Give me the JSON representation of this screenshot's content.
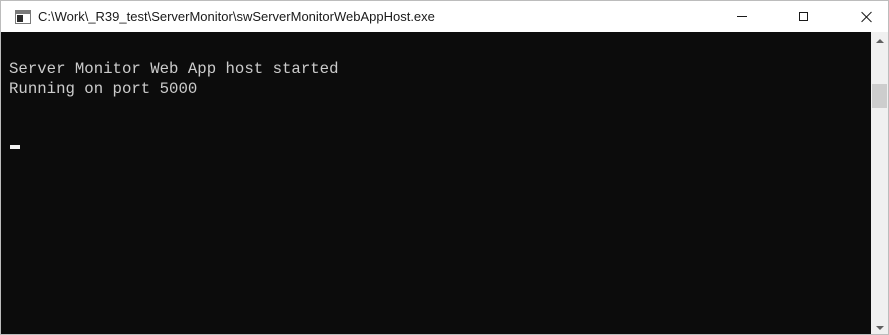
{
  "window": {
    "title": "C:\\Work\\_R39_test\\ServerMonitor\\swServerMonitorWebAppHost.exe",
    "icon": "console-app-icon"
  },
  "title_controls": {
    "minimize_icon": "minimize-icon",
    "maximize_icon": "maximize-icon",
    "close_icon": "close-icon"
  },
  "console": {
    "lines": [
      "Server Monitor Web App host started",
      "Running on port 5000"
    ],
    "background_color": "#0c0c0c",
    "text_color": "#cccccc"
  },
  "scrollbar": {
    "up_icon": "scroll-up-arrow-icon",
    "down_icon": "scroll-down-arrow-icon"
  }
}
